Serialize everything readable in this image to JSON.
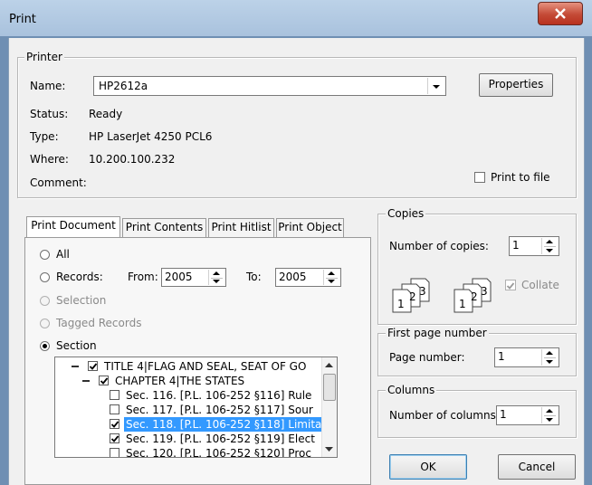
{
  "window": {
    "title": "Print"
  },
  "printer": {
    "legend": "Printer",
    "name_label": "Name:",
    "name_value": "HP2612a",
    "properties_button": "Properties",
    "status_label": "Status:",
    "status_value": "Ready",
    "type_label": "Type:",
    "type_value": "HP LaserJet 4250 PCL6",
    "where_label": "Where:",
    "where_value": "10.200.100.232",
    "comment_label": "Comment:",
    "print_to_file_label": "Print to file",
    "print_to_file_checked": false
  },
  "tabs": [
    {
      "label": "Print Document",
      "active": true
    },
    {
      "label": "Print Contents",
      "active": false
    },
    {
      "label": "Print Hitlist",
      "active": false
    },
    {
      "label": "Print Object",
      "active": false
    }
  ],
  "print_document": {
    "all_label": "All",
    "records_label": "Records:",
    "from_label": "From:",
    "from_value": "2005",
    "to_label": "To:",
    "to_value": "2005",
    "selection_label": "Selection",
    "tagged_records_label": "Tagged Records",
    "section_label": "Section",
    "selected_option": "Section"
  },
  "tree": {
    "items": [
      {
        "text": "TITLE 4|FLAG AND SEAL, SEAT OF GO",
        "checked": true,
        "level": 0,
        "expanded": true,
        "selected": false
      },
      {
        "text": "CHAPTER 4|THE STATES",
        "checked": true,
        "level": 1,
        "expanded": true,
        "selected": false
      },
      {
        "text": "Sec. 116. [P.L. 106-252 §116] Rule",
        "checked": false,
        "level": 2,
        "selected": false
      },
      {
        "text": "Sec. 117. [P.L. 106-252 §117] Sour",
        "checked": false,
        "level": 2,
        "selected": false
      },
      {
        "text": "Sec. 118. [P.L. 106-252 §118] Limita",
        "checked": true,
        "level": 2,
        "selected": true
      },
      {
        "text": "Sec. 119. [P.L. 106-252 §119] Elect",
        "checked": true,
        "level": 2,
        "selected": false
      },
      {
        "text": "Sec. 120. [P.L. 106-252 §120] Proc",
        "checked": false,
        "level": 2,
        "selected": false
      }
    ]
  },
  "copies": {
    "legend": "Copies",
    "number_label": "Number of copies:",
    "number_value": "1",
    "collate_label": "Collate",
    "collate_checked": true,
    "collate_enabled": false,
    "icon_digits": [
      "1",
      "2",
      "3"
    ]
  },
  "first_page": {
    "legend": "First page number",
    "page_label": "Page number:",
    "page_value": "1"
  },
  "columns": {
    "legend": "Columns",
    "label": "Number of columns:",
    "value": "1"
  },
  "buttons": {
    "ok": "OK",
    "cancel": "Cancel"
  },
  "colors": {
    "title_bar": "#bcd2e8",
    "close_button": "#c44a36",
    "selection": "#3399ff"
  }
}
